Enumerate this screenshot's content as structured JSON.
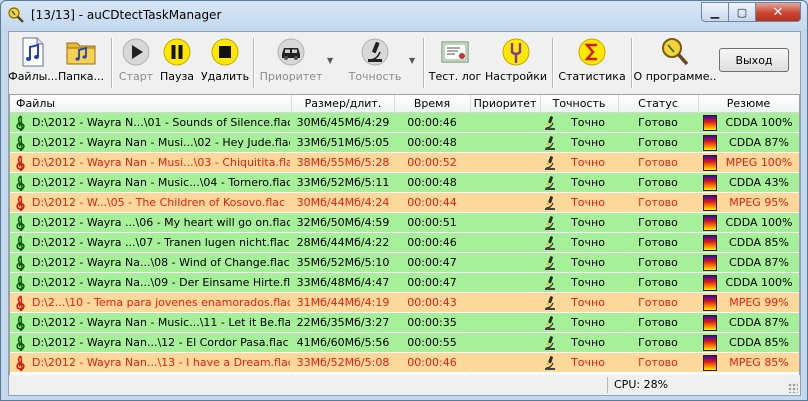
{
  "window": {
    "title": "[13/13] - auCDtectTaskManager"
  },
  "toolbar": {
    "files": "Файлы...",
    "folder": "Папка...",
    "start": "Старт",
    "pause": "Пауза",
    "delete": "Удалить",
    "priority": "Приоритет",
    "accuracy": "Точность",
    "test_log": "Тест. лог",
    "settings": "Настройки",
    "statistics": "Статистика",
    "about": "О программе..",
    "exit": "Выход"
  },
  "columns": [
    "Файлы",
    "Размер/длит.",
    "Время",
    "Приоритет",
    "Точность",
    "Статус",
    "Резюме"
  ],
  "rows": [
    {
      "file": "D:\\2012 - Wayra N...\\01 - Sounds of Silence.flac",
      "size": "30Мб/45Мб/4:29",
      "time": "00:00:46",
      "priority": "",
      "accuracy": "Точно",
      "status": "Готово",
      "summary": "CDDA 100%",
      "state": "ok"
    },
    {
      "file": "D:\\2012 - Wayra Nan - Musi...\\02 - Hey Jude.flac",
      "size": "33Мб/51Мб/5:05",
      "time": "00:00:48",
      "priority": "",
      "accuracy": "Точно",
      "status": "Готово",
      "summary": "CDDA 87%",
      "state": "ok"
    },
    {
      "file": "D:\\2012 - Wayra Nan - Musi...\\03 - Chiquitita.flac",
      "size": "38Мб/55Мб/5:28",
      "time": "00:00:52",
      "priority": "",
      "accuracy": "Точно",
      "status": "Готово",
      "summary": "MPEG 100%",
      "state": "warn"
    },
    {
      "file": "D:\\2012 - Wayra Nan - Music...\\04 - Tornero.flac",
      "size": "33Мб/52Мб/5:11",
      "time": "00:00:48",
      "priority": "",
      "accuracy": "Точно",
      "status": "Готово",
      "summary": "CDDA 43%",
      "state": "ok"
    },
    {
      "file": "D:\\2012 - W...\\05 - The Children of Kosovo.flac",
      "size": "30Мб/44Мб/4:24",
      "time": "00:00:44",
      "priority": "",
      "accuracy": "Точно",
      "status": "Готово",
      "summary": "MPEG 95%",
      "state": "warn"
    },
    {
      "file": "D:\\2012 - Wayra ...\\06 - My heart will go on.flac",
      "size": "32Мб/50Мб/4:59",
      "time": "00:00:51",
      "priority": "",
      "accuracy": "Точно",
      "status": "Готово",
      "summary": "CDDA 100%",
      "state": "ok"
    },
    {
      "file": "D:\\2012 - Wayra ...\\07 - Tranen lugen nicht.flac",
      "size": "28Мб/44Мб/4:22",
      "time": "00:00:46",
      "priority": "",
      "accuracy": "Точно",
      "status": "Готово",
      "summary": "CDDA 85%",
      "state": "ok"
    },
    {
      "file": "D:\\2012 - Wayra Na...\\08 - Wind of Change.flac",
      "size": "35Мб/52Мб/5:10",
      "time": "00:00:47",
      "priority": "",
      "accuracy": "Точно",
      "status": "Готово",
      "summary": "CDDA 87%",
      "state": "ok"
    },
    {
      "file": "D:\\2012 - Wayra Na...\\09 - Der Einsame Hirte.flac",
      "size": "33Мб/48Мб/4:47",
      "time": "00:00:47",
      "priority": "",
      "accuracy": "Точно",
      "status": "Готово",
      "summary": "CDDA 100%",
      "state": "ok"
    },
    {
      "file": "D:\\2...\\10 - Tema para jovenes enamorados.flac",
      "size": "31Мб/44Мб/4:19",
      "time": "00:00:43",
      "priority": "",
      "accuracy": "Точно",
      "status": "Готово",
      "summary": "MPEG 99%",
      "state": "warn"
    },
    {
      "file": "D:\\2012 - Wayra Nan - Music...\\11 - Let it Be.flac",
      "size": "22Мб/35Мб/3:27",
      "time": "00:00:35",
      "priority": "",
      "accuracy": "Точно",
      "status": "Готово",
      "summary": "CDDA 87%",
      "state": "ok"
    },
    {
      "file": "D:\\2012 - Wayra Nan...\\12 - El Cordor Pasa.flac",
      "size": "41Мб/60Мб/5:56",
      "time": "00:00:55",
      "priority": "",
      "accuracy": "Точно",
      "status": "Готово",
      "summary": "CDDA 85%",
      "state": "ok"
    },
    {
      "file": "D:\\2012 - Wayra Nan...\\13 - I have a Dream.flac",
      "size": "33Мб/52Мб/5:08",
      "time": "00:00:46",
      "priority": "",
      "accuracy": "Точно",
      "status": "Готово",
      "summary": "MPEG 85%",
      "state": "warn"
    }
  ],
  "statusbar": {
    "cpu": "CPU: 28%"
  },
  "colors": {
    "ok_row": "#a6f09a",
    "warn_row": "#fcd89a",
    "warn_text": "#e8201a"
  }
}
